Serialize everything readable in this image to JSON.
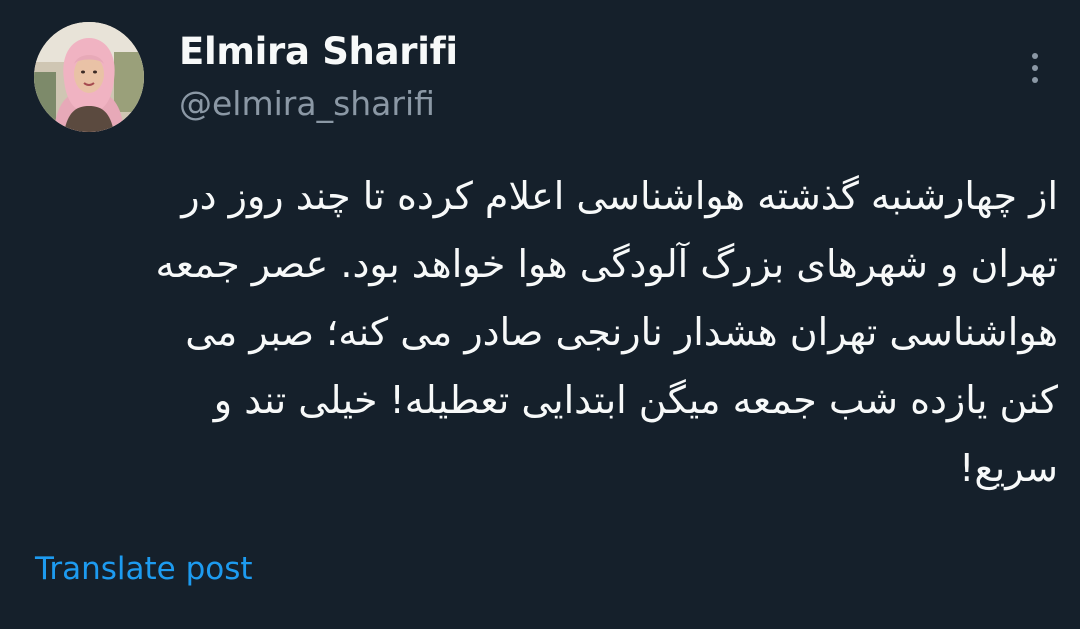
{
  "author": {
    "display_name": "Elmira Sharifi",
    "handle": "@elmira_sharifi",
    "avatar_icon": "profile-photo"
  },
  "post": {
    "text": "از چهارشنبه گذشته هواشناسی اعلام کرده تا چند روز در\nتهران و شهرهای بزرگ آلودگی هوا خواهد بود. عصر جمعه\nهواشناسی تهران هشدار نارنجی صادر می کنه؛ صبر می\nکنن یازده شب جمعه میگن ابتدایی تعطیله! خیلی تند و\nسریع!"
  },
  "actions": {
    "more_icon": "more-vertical-icon",
    "translate_label": "Translate post"
  },
  "colors": {
    "background": "#15202b",
    "primary_text": "#f7f9f9",
    "secondary_text": "#8b98a5",
    "link": "#1d9bf0"
  }
}
